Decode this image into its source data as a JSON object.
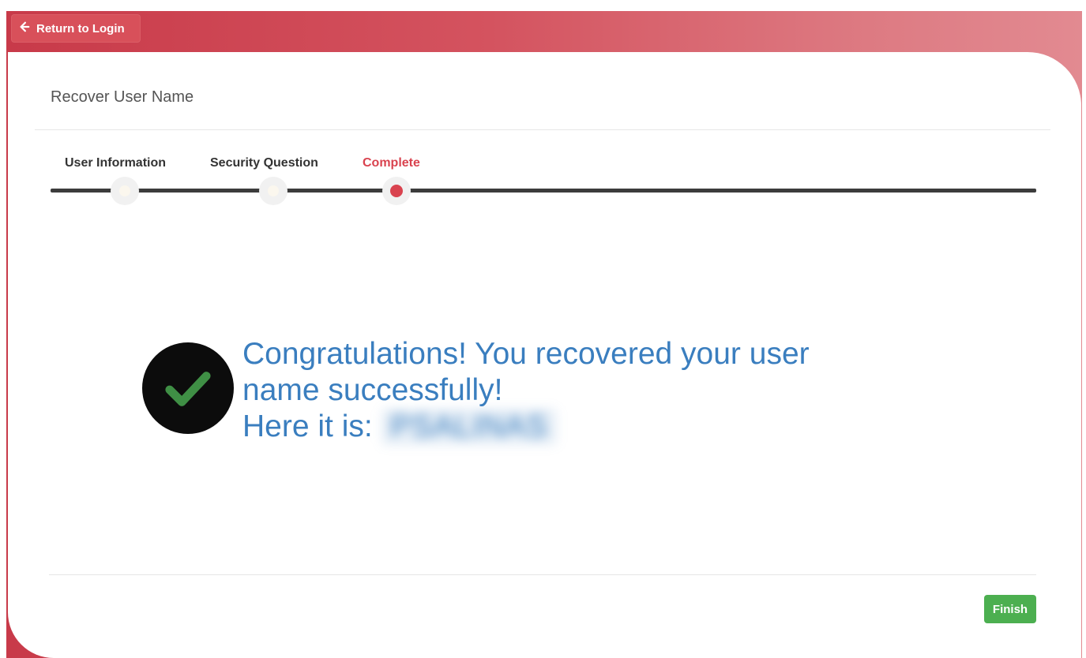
{
  "header": {
    "back_label": "Return to Login"
  },
  "page": {
    "title": "Recover User Name"
  },
  "steps": [
    {
      "label": "User Information",
      "state": "done"
    },
    {
      "label": "Security Question",
      "state": "done"
    },
    {
      "label": "Complete",
      "state": "active"
    }
  ],
  "result": {
    "line1": "Congratulations! You recovered your user",
    "line2": "name successfully!",
    "line3_prefix": "Here it is: ",
    "username": "PSALINAS"
  },
  "footer": {
    "finish_label": "Finish"
  },
  "colors": {
    "brand_red": "#c83a49",
    "active_step": "#d9434f",
    "message_blue": "#3a7ebf",
    "finish_green": "#4caf50"
  },
  "icons": {
    "back": "arrow-left-icon",
    "success": "checkmark-icon"
  }
}
